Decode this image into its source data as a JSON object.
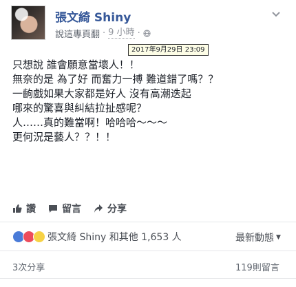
{
  "post": {
    "author": "張文綺 Shiny",
    "translation_link": "說這專頁翻",
    "time_label": "9 小時",
    "separator": "·",
    "timestamp_tooltip": "2017年9月29日 23:09",
    "lines": [
      "只想說 誰會願意當壞人！！",
      "無奈的是 為了好 而奮力一搏 難道錯了嗎？？",
      "一齣戲如果大家都是好人 沒有高潮迭起",
      "哪來的驚喜與糾結拉扯感呢？",
      "人……真的難當啊！哈哈哈～～～",
      "更何況是藝人？？！！"
    ]
  },
  "actions": {
    "like_label": "讚",
    "comment_label": "留言",
    "share_label": "分享"
  },
  "reactions": {
    "summary": "張文綺 Shiny 和其他 1,653 人",
    "icons": [
      "like-icon",
      "love-icon",
      "sad-icon"
    ]
  },
  "sort": {
    "label": "最新動態",
    "arrow": "▼"
  },
  "footer": {
    "shares": "3次分享",
    "comments": "119則留言"
  },
  "colors": {
    "link_blue": "#365899",
    "text": "#1d2129",
    "muted": "#90949c",
    "like_blue": "#4a7bd8",
    "love_red": "#ed4c5c",
    "sad_yellow": "#f7d245"
  }
}
